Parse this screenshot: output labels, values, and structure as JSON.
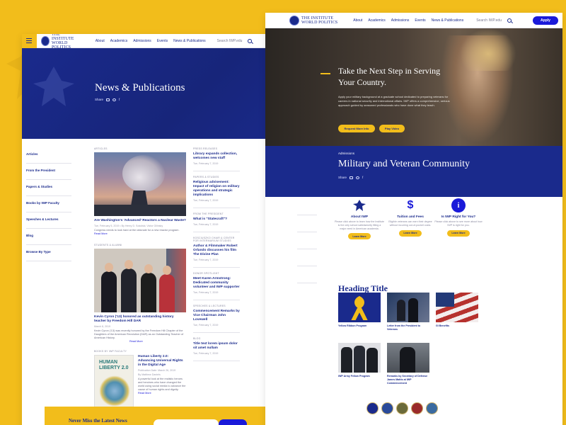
{
  "brand": {
    "logo_line1": "THE INSTITUTE",
    "logo_line2": "WORLD POLITICS",
    "primary_color": "#1a2a8c",
    "accent_color": "#f2bd1b",
    "button_color": "#1a1ad9"
  },
  "nav": {
    "links": [
      "About",
      "Academics",
      "Admissions",
      "Events",
      "News & Publications"
    ],
    "search_placeholder": "Search IWP.edu",
    "apply_label": "Apply"
  },
  "news_page": {
    "title": "News & Publications",
    "share_label": "Share",
    "sidebar": [
      "Articles",
      "From the President",
      "Papers & Studies",
      "Books by IWP Faculty",
      "Speeches & Lectures",
      "Blog",
      "Browse By Type"
    ],
    "articles_label": "ARTICLES",
    "featured": {
      "title": "Are Washington's 'Advanced' Reactors a Nuclear Waste?",
      "meta": "Tue, February 5, 2019  •  By Henry D. Sokolski, Victor Gilinsky",
      "body": "Congress needs to look hard at the rationale for a new reactor program.",
      "read_more": "Read More"
    },
    "students_label": "STUDENTS & ALUMNI",
    "student_article": {
      "title": "Kevin Cyron ('13) honored as outstanding history teacher by Freedom Hill DAR",
      "meta": "March 8, 2019",
      "body": "Kevin Cyron ('13) was recently honored by the Freedom Hill Chapter of the Daughters of the American Revolution (DAR) as an Outstanding Teacher of American History.",
      "read_more": "Read More"
    },
    "books_label": "BOOKS BY IWP FACULTY",
    "book": {
      "cover_title_1": "HUMAN",
      "cover_title_2": "LIBERTY 2.0",
      "title": "Human Liberty 2.0: Advancing Universal Rights in the Digital Age",
      "meta": "Publication Date: March 26, 2019",
      "author": "By Matthew Daniels",
      "body": "A powerful look at the realistic heroes and heroines who have changed the world using social media to advance the cause of human rights and dignity.",
      "read_more": "Read More"
    },
    "right_column": [
      {
        "label": "PRESS RELEASES",
        "title": "Library expands collection, welcomes new staff",
        "date": "Tue, February 7, 2019"
      },
      {
        "label": "PAPERS & STUDIES",
        "title": "Religious advisement: Impact of religion on military operations and strategic implications",
        "date": "Tue, February 7, 2019"
      },
      {
        "label": "FROM THE PRESIDENT",
        "title": "What is \"Statecraft\"?",
        "date": "Tue, February 7, 2019"
      },
      {
        "label": "KOSCIUSZKO CHAIR & CENTER FOR INTERMARIUM STUDIES",
        "title": "Author & Filmmaker Robert Orlando discusses his film The Divine Plan",
        "date": "Tue, February 7, 2019"
      },
      {
        "label": "DONOR SPOTLIGHT",
        "title": "Meet Karen Armstrong: Dedicated community volunteer and IWP supporter",
        "date": "Tue, February 7, 2019"
      },
      {
        "label": "SPEECHES & LECTURES",
        "title": "Commencement Remarks by Vice Chairman John Lovewell",
        "date": "Tue, February 7, 2019"
      },
      {
        "label": "BLOG",
        "title": "Title text lorem ipsum dolor sit amet nullam",
        "date": "Tue, February 7, 2019"
      }
    ],
    "newsletter_title": "Never Miss the Latest News"
  },
  "admissions_page": {
    "hero_title": "Take the Next Step in Serving Your Country.",
    "hero_body": "Apply your military background at a graduate school dedicated to preparing veterans for careers in national security and international affairs. IWP offers a comprehensive, serious approach guided by seasoned professionals who have done what they teach.",
    "hero_btn_1": "Request More Info",
    "hero_btn_2": "Play Video",
    "section_label": "Admissions",
    "section_title": "Military and Veteran Community",
    "share_label": "Share",
    "features": [
      {
        "title": "About IWP",
        "body": "Please click above to learn how the Institute is the only school satisfactorily filling a major need in American academia.",
        "btn": "Learn More",
        "icon": "eagle-icon",
        "icon_color": "#1a2a8c"
      },
      {
        "title": "Tuition and Fees",
        "body": "Eligible veterans can earn their degree without incurring out-of-pocket costs.",
        "btn": "Learn More",
        "icon": "dollar-icon",
        "icon_color": "#1a1ad9"
      },
      {
        "title": "Is IWP Right for You?",
        "body": "Please click above to see more about how IWP is right for you.",
        "btn": "Learn More",
        "icon": "info-icon",
        "icon_color": "#1a1ad9"
      }
    ],
    "heading_title": "Heading Title",
    "grid": [
      {
        "caption": "Yellow Ribbon Program",
        "thumb_color": "#1a2a8c"
      },
      {
        "caption": "Letter from the President to Veterans",
        "thumb_color": "#243a62"
      },
      {
        "caption": "GI Benefits",
        "thumb_color": "#b6322e"
      },
      {
        "caption": "IWP Army Fellow Program",
        "thumb_color": "#20242c"
      },
      {
        "caption": "Remarks by Secretary of Defense James Mattis at IWP Commencement",
        "thumb_color": "#5a5f66"
      }
    ],
    "seals": [
      "navy-seal",
      "air-force-seal",
      "army-seal",
      "marine-corps-seal",
      "coast-guard-seal"
    ]
  }
}
